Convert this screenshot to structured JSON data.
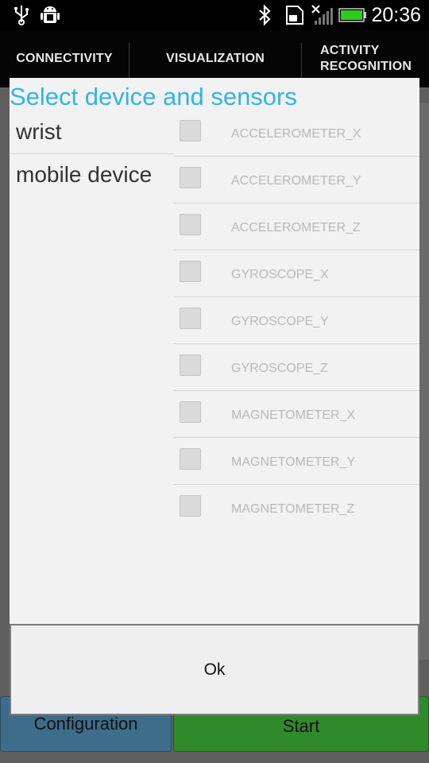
{
  "status_bar": {
    "icons": [
      "usb-icon",
      "android-debug-icon",
      "bluetooth-icon",
      "sd-card-icon",
      "signal-off-icon",
      "battery-icon"
    ],
    "time": "20:36"
  },
  "tabs": [
    {
      "label": "CONNECTIVITY"
    },
    {
      "label": "VISUALIZATION"
    },
    {
      "label_line1": "ACTIVITY",
      "label_line2": "RECOGNITION"
    }
  ],
  "background_buttons": {
    "configuration": "Configuration",
    "start": "Start"
  },
  "dialog": {
    "title": "Select device and sensors",
    "devices": [
      "wrist",
      "mobile device"
    ],
    "sensors": [
      {
        "label": "ACCELEROMETER_X",
        "checked": false
      },
      {
        "label": "ACCELEROMETER_Y",
        "checked": false
      },
      {
        "label": "ACCELEROMETER_Z",
        "checked": false
      },
      {
        "label": "GYROSCOPE_X",
        "checked": false
      },
      {
        "label": "GYROSCOPE_Y",
        "checked": false
      },
      {
        "label": "GYROSCOPE_Z",
        "checked": false
      },
      {
        "label": "MAGNETOMETER_X",
        "checked": false
      },
      {
        "label": "MAGNETOMETER_Y",
        "checked": false
      },
      {
        "label": "MAGNETOMETER_Z",
        "checked": false
      }
    ],
    "ok_label": "Ok"
  },
  "colors": {
    "accent": "#33b5e5",
    "battery": "#2ecc1f",
    "start_button": "#2f8a2a",
    "configuration_button": "#3d6d8a"
  }
}
